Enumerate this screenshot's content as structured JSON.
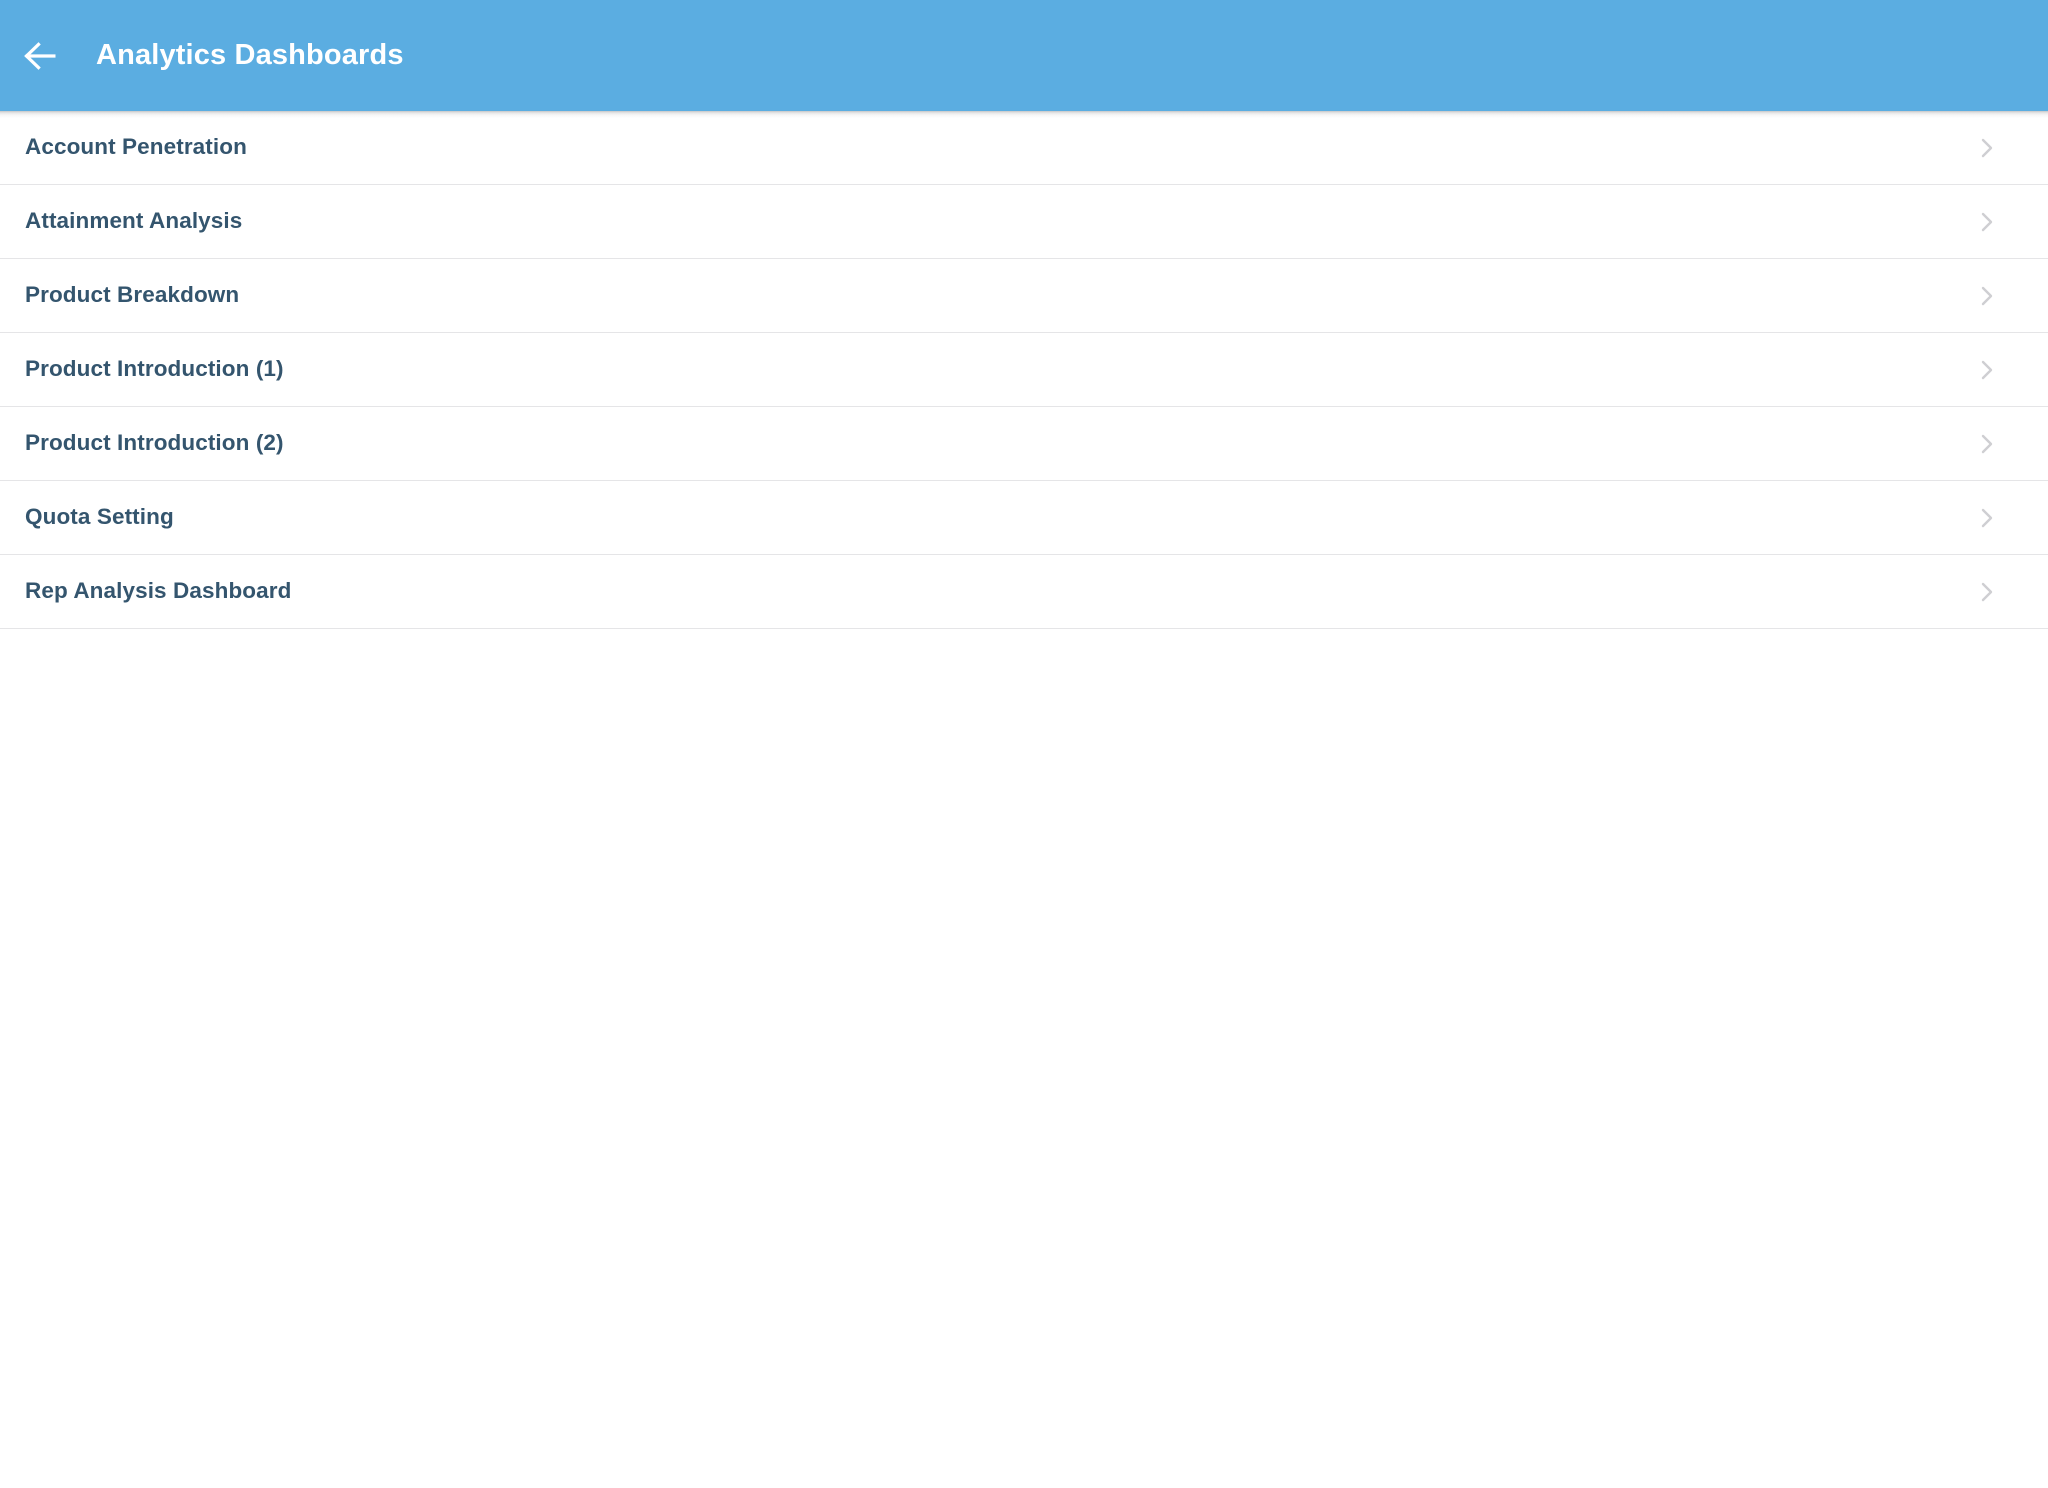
{
  "header": {
    "title": "Analytics Dashboards",
    "back_icon": "arrow-left-icon",
    "background_color": "#5bade1",
    "title_color": "#ffffff"
  },
  "list": {
    "row_chevron_icon": "chevron-right-icon",
    "label_color": "#34556e",
    "divider_color": "#e5e5e7",
    "chevron_color": "#cfcfd2",
    "items": [
      {
        "label": "Account Penetration"
      },
      {
        "label": "Attainment Analysis"
      },
      {
        "label": "Product Breakdown"
      },
      {
        "label": "Product Introduction (1)"
      },
      {
        "label": "Product Introduction (2)"
      },
      {
        "label": "Quota Setting"
      },
      {
        "label": "Rep Analysis Dashboard"
      }
    ]
  }
}
